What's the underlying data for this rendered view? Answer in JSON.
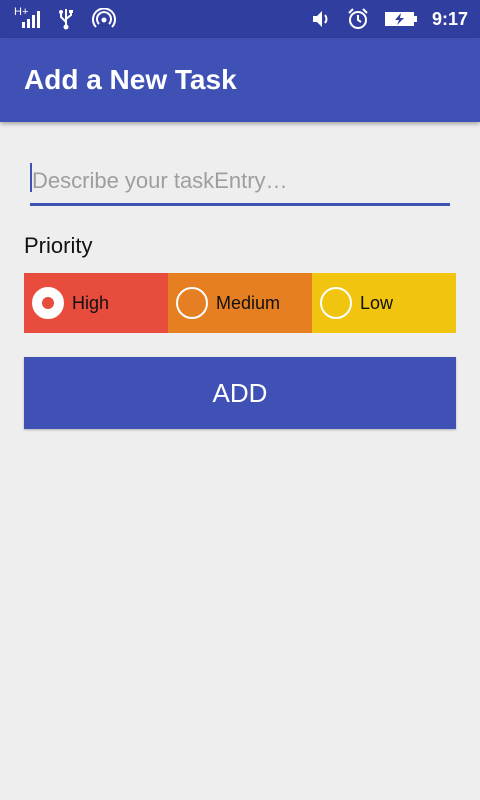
{
  "status_bar": {
    "network_type": "H+",
    "time": "9:17",
    "icons": [
      "signal-icon",
      "usb-icon",
      "hotspot-icon",
      "vibrate-icon",
      "alarm-icon",
      "battery-charging-icon"
    ]
  },
  "app_bar": {
    "title": "Add a New Task"
  },
  "task_input": {
    "placeholder": "Describe your taskEntry…",
    "value": ""
  },
  "priority": {
    "label": "Priority",
    "selected": "High",
    "options": [
      {
        "label": "High",
        "color": "#e74c3c"
      },
      {
        "label": "Medium",
        "color": "#e67e22"
      },
      {
        "label": "Low",
        "color": "#f1c40f"
      }
    ]
  },
  "add_button": {
    "label": "ADD"
  },
  "colors": {
    "primary": "#3f51b5",
    "primary_dark": "#303f9f",
    "background": "#eeeeee"
  }
}
